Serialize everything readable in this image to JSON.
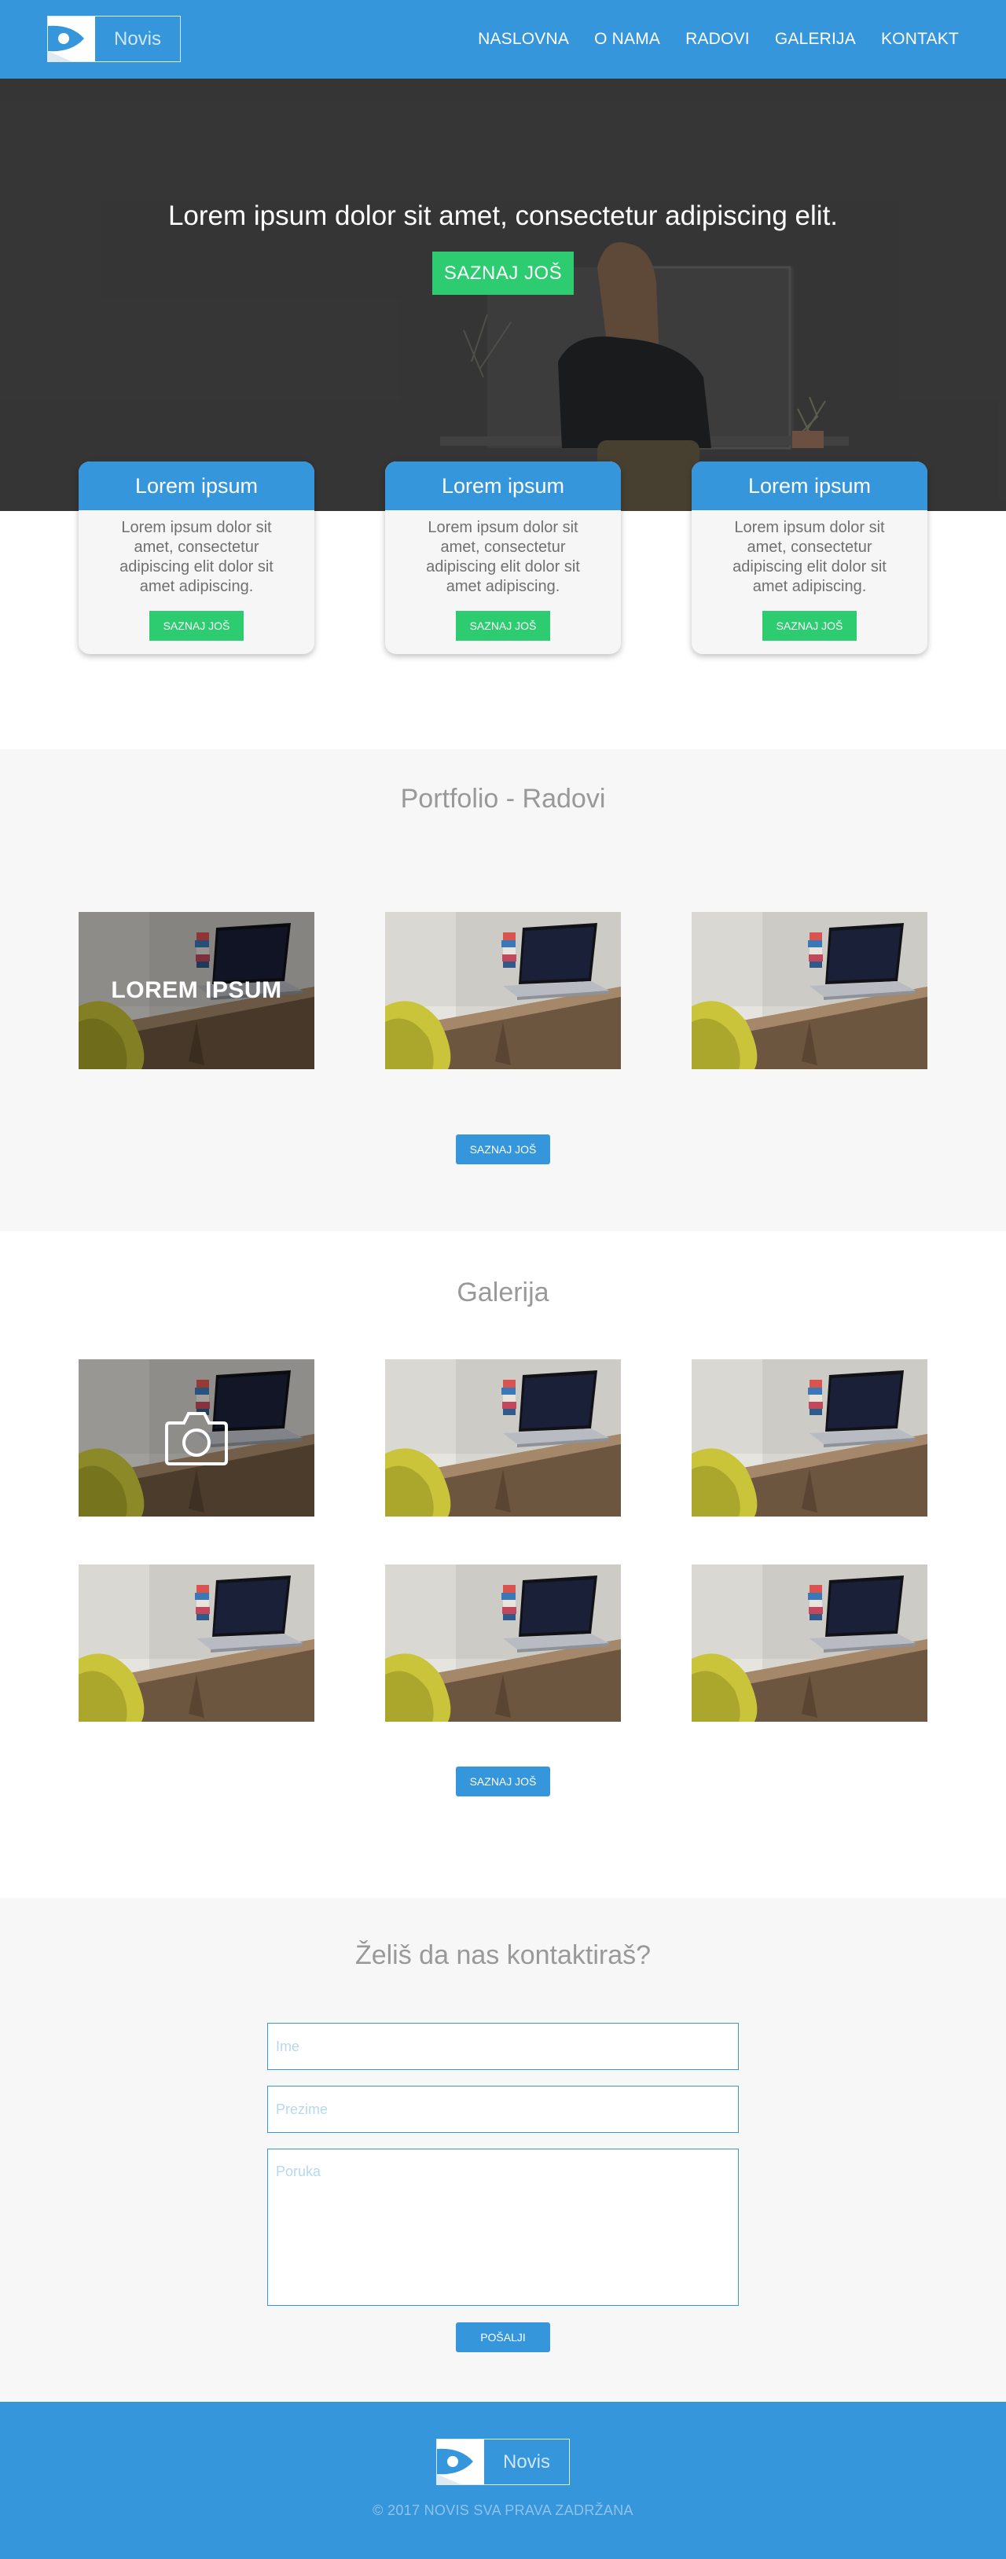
{
  "header": {
    "logo_text": "Novis",
    "nav": [
      "NASLOVNA",
      "O NAMA",
      "RADOVI",
      "GALERIJA",
      "KONTAKT"
    ]
  },
  "hero": {
    "title": "Lorem ipsum dolor sit amet, consectetur adipiscing elit.",
    "button": "SAZNAJ JOŠ"
  },
  "cards": [
    {
      "title": "Lorem ipsum",
      "text": "Lorem ipsum dolor sit amet, consectetur adipiscing elit dolor sit amet adipiscing.",
      "button": "SAZNAJ JOŠ"
    },
    {
      "title": "Lorem ipsum",
      "text": "Lorem ipsum dolor sit amet, consectetur adipiscing elit dolor sit amet adipiscing.",
      "button": "SAZNAJ JOŠ"
    },
    {
      "title": "Lorem ipsum",
      "text": "Lorem ipsum dolor sit amet, consectetur adipiscing elit dolor sit amet adipiscing.",
      "button": "SAZNAJ JOŠ"
    }
  ],
  "portfolio": {
    "title": "Portfolio - Radovi",
    "overlay_text": "LOREM IPSUM",
    "button": "SAZNAJ JOŠ"
  },
  "gallery": {
    "title": "Galerija",
    "overlay_icon": "camera-icon",
    "button": "SAZNAJ JOŠ"
  },
  "contact": {
    "title": "Želiš da nas kontaktiraš?",
    "name_placeholder": "Ime",
    "surname_placeholder": "Prezime",
    "message_placeholder": "Poruka",
    "button": "POŠALJI"
  },
  "footer": {
    "logo_text": "Novis",
    "copyright": "© 2017 NOVIS SVA PRAVA ZADRŽANA"
  },
  "colors": {
    "primary": "#3596db",
    "accent": "#2ecc71",
    "section_bg": "#f7f7f7"
  }
}
